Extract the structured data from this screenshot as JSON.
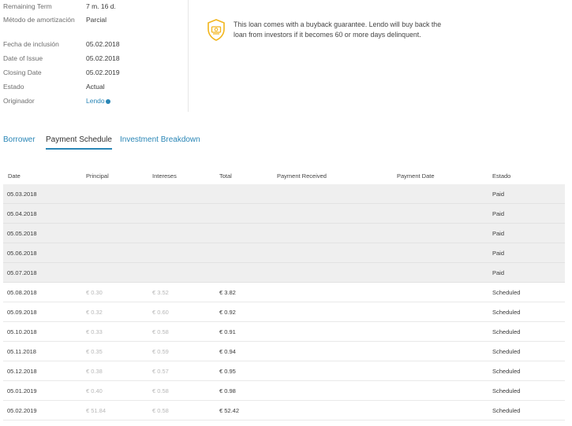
{
  "loan_details": [
    {
      "label": "Remaining Term",
      "value": "7 m. 16 d."
    },
    {
      "label": "Método de amortización",
      "value": "Parcial"
    },
    {
      "label": "Fecha de inclusión",
      "value": "05.02.2018"
    },
    {
      "label": "Date of Issue",
      "value": "05.02.2018"
    },
    {
      "label": "Closing Date",
      "value": "05.02.2019"
    },
    {
      "label": "Estado",
      "value": "Actual"
    },
    {
      "label": "Originador",
      "value": "Lendo"
    }
  ],
  "buyback": {
    "icon": "shield-money-icon",
    "text": "This loan comes with a buyback guarantee. Lendo will buy back the loan from investors if it becomes 60 or more days delinquent."
  },
  "tabs": [
    {
      "label": "Borrower",
      "active": false
    },
    {
      "label": "Payment Schedule",
      "active": true
    },
    {
      "label": "Investment Breakdown",
      "active": false
    }
  ],
  "schedule": {
    "columns": [
      "Date",
      "Principal",
      "Intereses",
      "Total",
      "Payment Received",
      "Payment Date",
      "Estado"
    ],
    "rows": [
      {
        "date": "05.03.2018",
        "principal": "",
        "interest": "",
        "total": "",
        "received": "",
        "payment_date": "",
        "status": "Paid"
      },
      {
        "date": "05.04.2018",
        "principal": "",
        "interest": "",
        "total": "",
        "received": "",
        "payment_date": "",
        "status": "Paid"
      },
      {
        "date": "05.05.2018",
        "principal": "",
        "interest": "",
        "total": "",
        "received": "",
        "payment_date": "",
        "status": "Paid"
      },
      {
        "date": "05.06.2018",
        "principal": "",
        "interest": "",
        "total": "",
        "received": "",
        "payment_date": "",
        "status": "Paid"
      },
      {
        "date": "05.07.2018",
        "principal": "",
        "interest": "",
        "total": "",
        "received": "",
        "payment_date": "",
        "status": "Paid"
      },
      {
        "date": "05.08.2018",
        "principal": "€ 0.30",
        "interest": "€ 3.52",
        "total": "€ 3.82",
        "received": "",
        "payment_date": "",
        "status": "Scheduled"
      },
      {
        "date": "05.09.2018",
        "principal": "€ 0.32",
        "interest": "€ 0.60",
        "total": "€ 0.92",
        "received": "",
        "payment_date": "",
        "status": "Scheduled"
      },
      {
        "date": "05.10.2018",
        "principal": "€ 0.33",
        "interest": "€ 0.58",
        "total": "€ 0.91",
        "received": "",
        "payment_date": "",
        "status": "Scheduled"
      },
      {
        "date": "05.11.2018",
        "principal": "€ 0.35",
        "interest": "€ 0.59",
        "total": "€ 0.94",
        "received": "",
        "payment_date": "",
        "status": "Scheduled"
      },
      {
        "date": "05.12.2018",
        "principal": "€ 0.38",
        "interest": "€ 0.57",
        "total": "€ 0.95",
        "received": "",
        "payment_date": "",
        "status": "Scheduled"
      },
      {
        "date": "05.01.2019",
        "principal": "€ 0.40",
        "interest": "€ 0.58",
        "total": "€ 0.98",
        "received": "",
        "payment_date": "",
        "status": "Scheduled"
      },
      {
        "date": "05.02.2019",
        "principal": "€ 51.84",
        "interest": "€ 0.58",
        "total": "€ 52.42",
        "received": "",
        "payment_date": "",
        "status": "Scheduled"
      }
    ]
  },
  "colors": {
    "accent": "#2a86b6",
    "shield": "#f2b51c",
    "paid_row": "#efefef"
  }
}
